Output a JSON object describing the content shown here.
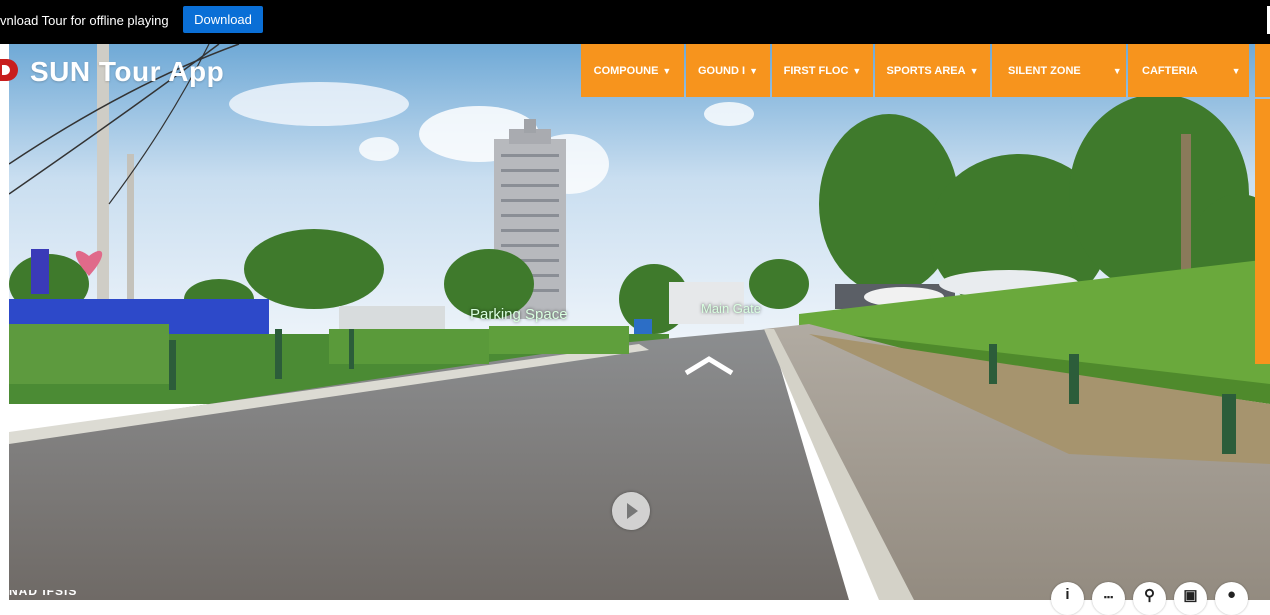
{
  "topbar": {
    "message": "vnload Tour for offline playing",
    "download_label": "Download"
  },
  "header": {
    "app_title": "SUN Tour App"
  },
  "nav": {
    "items": [
      {
        "label": "COMPOUNE"
      },
      {
        "label": "GOUND I"
      },
      {
        "label": "FIRST FLOC"
      },
      {
        "label": "SPORTS AREA"
      },
      {
        "label": "SILENT ZONE"
      },
      {
        "label": "CAFTERIA"
      }
    ]
  },
  "hotspots": {
    "parking": "Parking Space",
    "main_gate": "Main Gate"
  },
  "footer": {
    "partial_text": "NAD IFSIS"
  },
  "controls": [
    {
      "icon": "info-icon",
      "glyph": "i"
    },
    {
      "icon": "thumbnails-icon",
      "glyph": "▪▪▪"
    },
    {
      "icon": "location-icon",
      "glyph": "⚲"
    },
    {
      "icon": "gallery-icon",
      "glyph": "▣"
    },
    {
      "icon": "map-pin-icon",
      "glyph": "●"
    }
  ],
  "colors": {
    "menu_orange": "#f7941d",
    "download_blue": "#0a6fd6",
    "hotspot_text": "#d9ffe0"
  }
}
